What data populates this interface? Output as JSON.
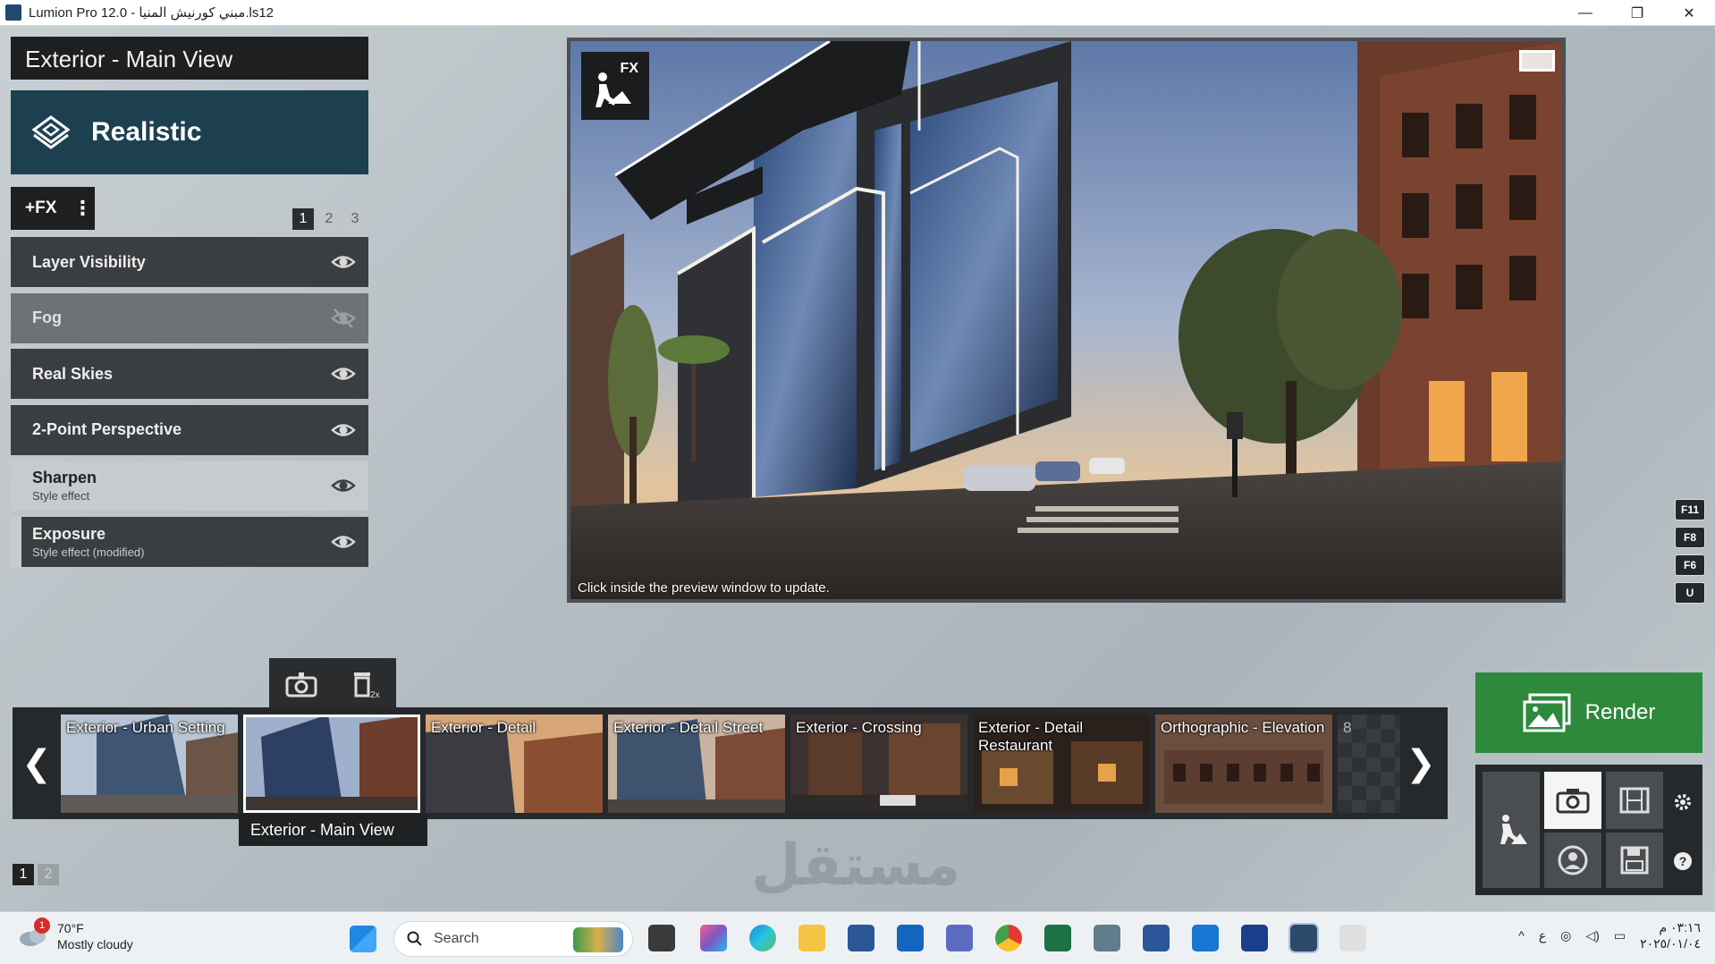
{
  "window": {
    "title": "Lumion Pro 12.0  - مبني كورنيش المنيا.ls12",
    "minimize": "—",
    "restore": "❐",
    "close": "✕"
  },
  "left_panel": {
    "view_title": "Exterior - Main View",
    "style_label": "Realistic",
    "fx_button": "+FX",
    "fx_menu": "⋮",
    "pages": [
      "1",
      "2",
      "3"
    ],
    "effects": [
      {
        "name": "Layer Visibility",
        "sub": "",
        "visible": true
      },
      {
        "name": "Fog",
        "sub": "",
        "visible": false
      },
      {
        "name": "Real Skies",
        "sub": "",
        "visible": true
      },
      {
        "name": "2-Point Perspective",
        "sub": "",
        "visible": true
      },
      {
        "name": "Sharpen",
        "sub": "Style effect",
        "visible": true
      },
      {
        "name": "Exposure",
        "sub": "Style effect (modified)",
        "visible": true
      }
    ]
  },
  "preview": {
    "fx_badge": "FX",
    "hint": "Click inside the preview window to update."
  },
  "fkeys": [
    "F11",
    "F8",
    "F6",
    "U"
  ],
  "filmstrip": {
    "prev": "❮",
    "next": "❯",
    "thumbs": [
      {
        "label": "Exterior - Urban Setting"
      },
      {
        "label": ""
      },
      {
        "label": "Exterior - Detail"
      },
      {
        "label": "Exterior - Detail Street"
      },
      {
        "label": "Exterior - Crossing"
      },
      {
        "label": "Exterior - Detail Restaurant"
      },
      {
        "label": "Orthographic - Elevation"
      },
      {
        "label": "8"
      }
    ],
    "active_label": "Exterior - Main View",
    "pages": [
      "1",
      "2"
    ]
  },
  "render": {
    "label": "Render"
  },
  "watermark": "مستقل",
  "taskbar": {
    "weather_badge": "1",
    "temperature": "70°F",
    "condition": "Mostly cloudy",
    "search": "Search",
    "lang": "ع",
    "time": "٠٣:١٦ م",
    "date": "٢٠٢٥/٠١/٠٤"
  },
  "colors": {
    "style_box": "#1d4050",
    "render_green": "#2d8a3c",
    "panel_dark": "#1d1f21"
  }
}
